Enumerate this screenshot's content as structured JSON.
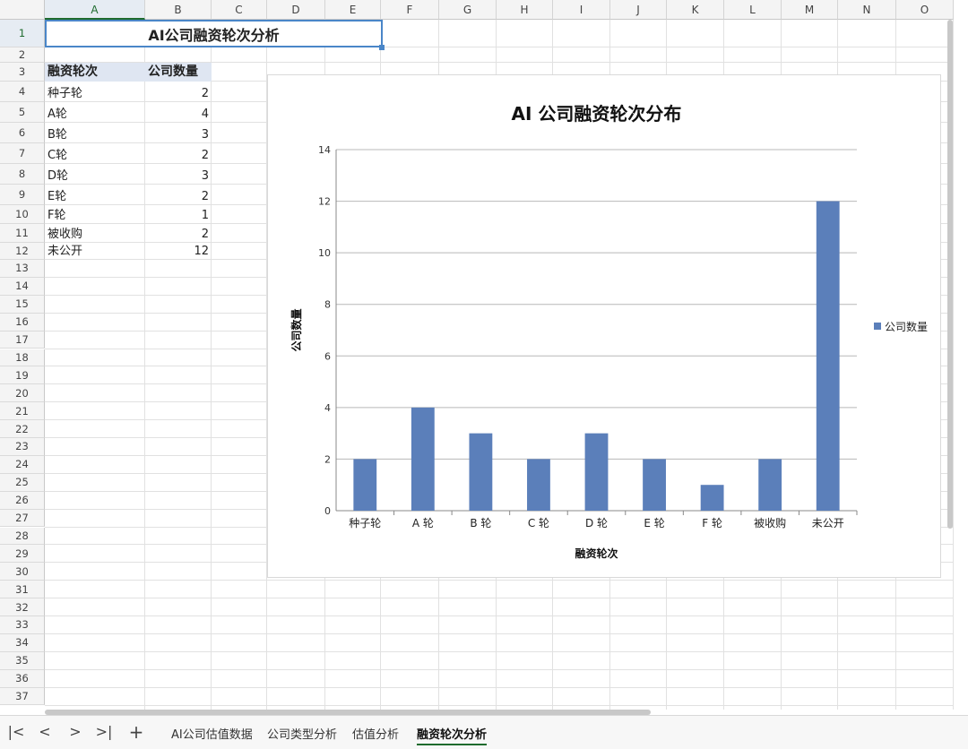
{
  "columns": [
    "A",
    "B",
    "C",
    "D",
    "E",
    "F",
    "G",
    "H",
    "I",
    "J",
    "K",
    "L",
    "M",
    "N",
    "O"
  ],
  "rows": [
    "1",
    "2",
    "3",
    "4",
    "5",
    "6",
    "7",
    "8",
    "9",
    "10",
    "11",
    "12",
    "13",
    "14",
    "15",
    "16",
    "17",
    "18",
    "19",
    "20",
    "21",
    "22",
    "23",
    "24",
    "25",
    "26",
    "27",
    "28",
    "29",
    "30",
    "31",
    "32",
    "33",
    "34",
    "35",
    "36",
    "37"
  ],
  "sheet": {
    "title": "AI公司融资轮次分析",
    "header_round": "融资轮次",
    "header_count": "公司数量",
    "data": [
      {
        "round": "种子轮",
        "count": "2"
      },
      {
        "round": "A轮",
        "count": "4"
      },
      {
        "round": "B轮",
        "count": "3"
      },
      {
        "round": "C轮",
        "count": "2"
      },
      {
        "round": "D轮",
        "count": "3"
      },
      {
        "round": "E轮",
        "count": "2"
      },
      {
        "round": "F轮",
        "count": "1"
      },
      {
        "round": "被收购",
        "count": "2"
      },
      {
        "round": "未公开",
        "count": "12"
      }
    ]
  },
  "chart_data": {
    "type": "bar",
    "title": "AI 公司融资轮次分布",
    "xlabel": "融资轮次",
    "ylabel": "公司数量",
    "categories": [
      "种子轮",
      "A 轮",
      "B 轮",
      "C 轮",
      "D 轮",
      "E 轮",
      "F 轮",
      "被收购",
      "未公开"
    ],
    "series": [
      {
        "name": "公司数量",
        "values": [
          2,
          4,
          3,
          2,
          3,
          2,
          1,
          2,
          12
        ],
        "color": "#5b7fba"
      }
    ],
    "ylim": [
      0,
      14
    ],
    "yticks": [
      0,
      2,
      4,
      6,
      8,
      10,
      12,
      14
    ],
    "grid": true,
    "legend": "right"
  },
  "tabbar": {
    "nav": {
      "first": "|<",
      "prev": "<",
      "next": ">",
      "last": ">|",
      "add": "+"
    },
    "tabs": [
      "AI公司估值数据",
      "公司类型分析",
      "估值分析",
      "融资轮次分析"
    ],
    "active": 3
  }
}
